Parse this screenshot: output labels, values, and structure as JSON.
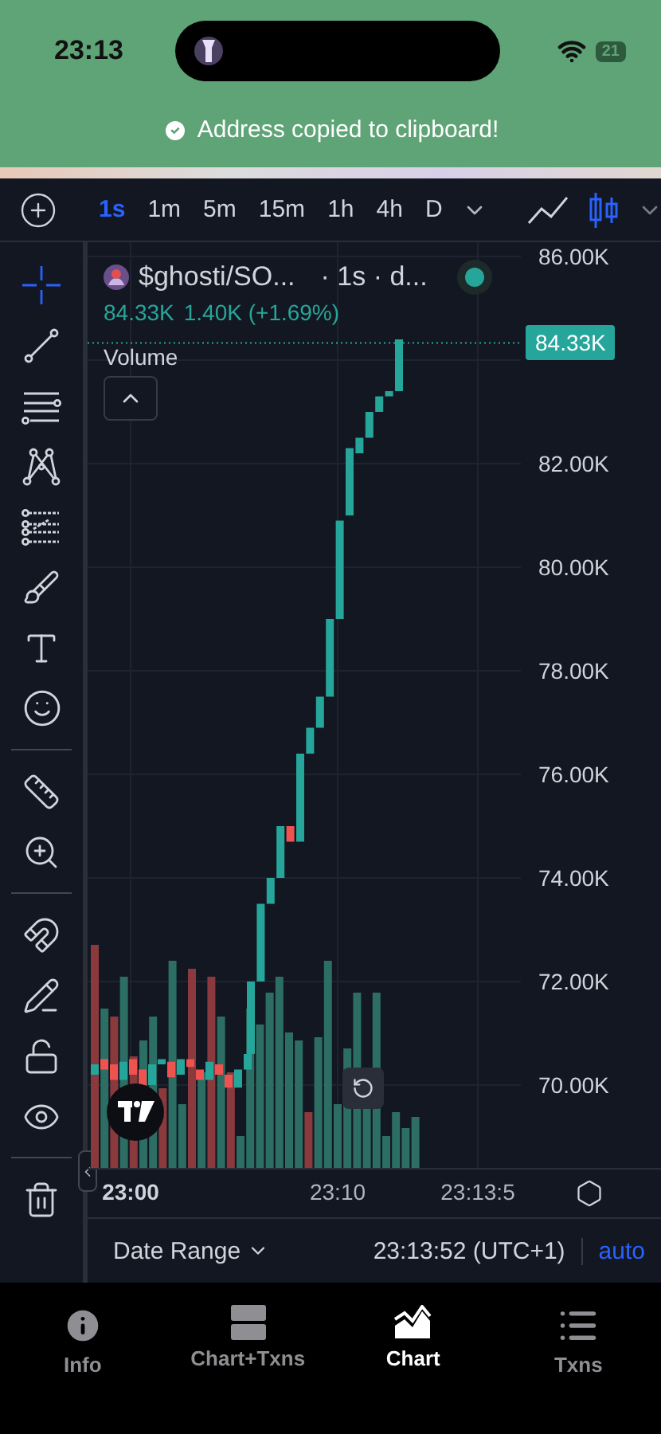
{
  "status_bar": {
    "time": "23:13",
    "battery": "21"
  },
  "toast": {
    "message": "Address copied to clipboard!"
  },
  "toolbar": {
    "intervals": [
      {
        "label": "1s",
        "selected": true
      },
      {
        "label": "1m",
        "selected": false
      },
      {
        "label": "5m",
        "selected": false
      },
      {
        "label": "15m",
        "selected": false
      },
      {
        "label": "1h",
        "selected": false
      },
      {
        "label": "4h",
        "selected": false
      },
      {
        "label": "D",
        "selected": false
      }
    ],
    "chart_types": [
      {
        "kind": "line",
        "selected": false
      },
      {
        "kind": "candles",
        "selected": true
      }
    ]
  },
  "tools": [
    {
      "kind": "crosshair",
      "selected": true
    },
    {
      "kind": "trend-line",
      "selected": false
    },
    {
      "kind": "horizontal-lines",
      "selected": false
    },
    {
      "kind": "pattern",
      "selected": false
    },
    {
      "kind": "fib",
      "selected": false
    },
    {
      "kind": "brush",
      "selected": false
    },
    {
      "kind": "text",
      "selected": false
    },
    {
      "kind": "emoji",
      "selected": false
    },
    {
      "kind": "divider"
    },
    {
      "kind": "ruler",
      "selected": false
    },
    {
      "kind": "zoom",
      "selected": false
    },
    {
      "kind": "divider"
    },
    {
      "kind": "magnet",
      "selected": false
    },
    {
      "kind": "lock-drawings",
      "selected": false
    },
    {
      "kind": "lock",
      "selected": false
    },
    {
      "kind": "hide",
      "selected": false
    },
    {
      "kind": "divider"
    },
    {
      "kind": "trash",
      "selected": false
    }
  ],
  "legend": {
    "symbol": "$ghosti/SO...",
    "details": "· 1s · d...",
    "live": true,
    "price": "84.33K",
    "change": "1.40K (+1.69%)",
    "study": "Volume"
  },
  "price_axis": {
    "ticks": [
      "86.00K",
      "82.00K",
      "80.00K",
      "78.00K",
      "76.00K",
      "74.00K",
      "72.00K",
      "70.00K"
    ],
    "last_price": "84.33K"
  },
  "time_axis": {
    "ticks": [
      "23:00",
      "23:10",
      "23:13:5"
    ]
  },
  "footer": {
    "range_label": "Date Range",
    "clock": "23:13:52 (UTC+1)",
    "scale": "auto"
  },
  "nav": [
    {
      "label": "Info",
      "selected": false
    },
    {
      "label": "Chart+Txns",
      "selected": false
    },
    {
      "label": "Chart",
      "selected": true
    },
    {
      "label": "Txns",
      "selected": false
    }
  ]
}
